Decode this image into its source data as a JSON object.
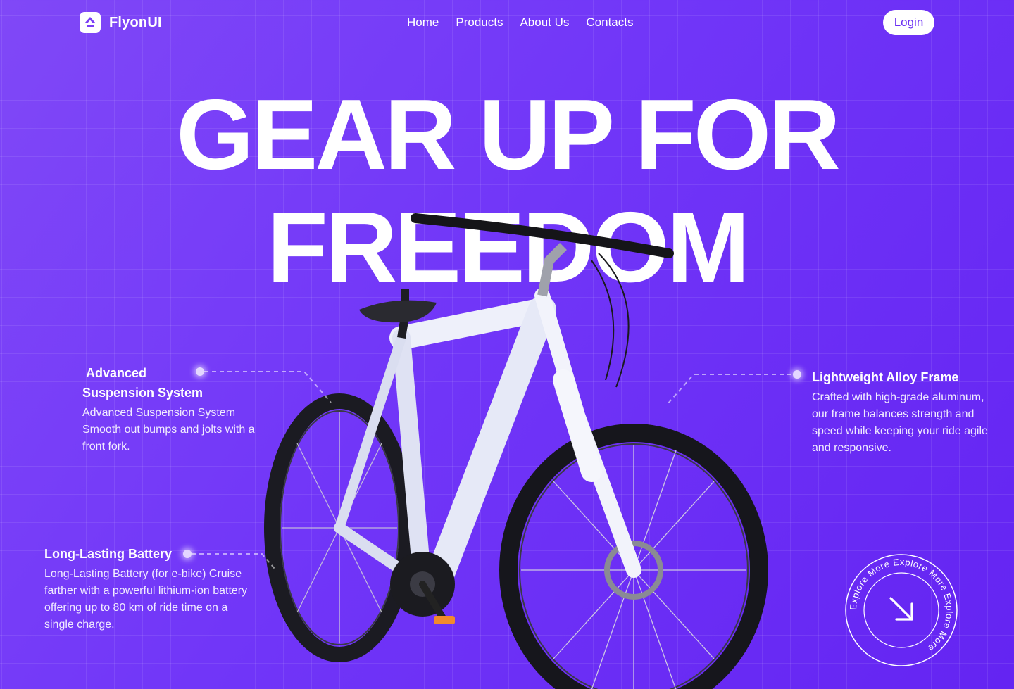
{
  "brand": {
    "name": "FlyonUI",
    "logo_icon": "flyonui-logo-icon"
  },
  "nav": {
    "items": [
      "Home",
      "Products",
      "About Us",
      "Contacts"
    ]
  },
  "header": {
    "login_label": "Login"
  },
  "hero": {
    "title_line1": "GEAR UP FOR",
    "title_line2": "FREEDOM",
    "image": "white mountain bicycle"
  },
  "features": [
    {
      "title_line1": "Advanced",
      "title_line2": "Suspension System",
      "description": "Advanced Suspension System Smooth out bumps and jolts with a front fork."
    },
    {
      "title": "Lightweight Alloy Frame",
      "description": "Crafted with high-grade aluminum, our frame balances strength and speed while keeping your ride agile and responsive."
    },
    {
      "title": "Long-Lasting Battery",
      "description": "Long-Lasting Battery (for e-bike) Cruise farther with a powerful lithium-ion battery offering up to 80 km of ride time on a single charge."
    }
  ],
  "explore": {
    "ring_text": "Explore More Explore More Explore More ",
    "icon": "arrow-down-right-icon"
  },
  "colors": {
    "bg_start": "#8048f7",
    "bg_end": "#6424f2",
    "accent": "#6a2ef3",
    "text": "#ffffff"
  }
}
